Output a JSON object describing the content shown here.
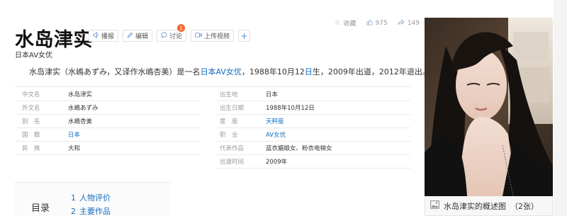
{
  "stats": {
    "favorite_label": "收藏",
    "likes": "975",
    "shares": "149"
  },
  "title": "水岛津实",
  "actions": {
    "broadcast": "播报",
    "edit": "编辑",
    "discuss": "讨论",
    "discuss_badge": "1",
    "upload_video": "上传视频",
    "add": "+"
  },
  "subtitle": "日本AV女优",
  "summary": {
    "part1": "水岛津实（水嶋あずみ，又译作水嶋杏美）是一名",
    "link1": "日本AV女优",
    "part2": "，1988年10月12",
    "link2": "日",
    "part3": "生，2009年出道，2012年退出。"
  },
  "infobox": {
    "left": [
      {
        "label": "中文名",
        "value": "水岛津实"
      },
      {
        "label": "外文名",
        "value": "水嶋あずみ"
      },
      {
        "label": "别　名",
        "value": "水嶋杏美"
      },
      {
        "label": "国　籍",
        "value": "日本"
      },
      {
        "label": "民　族",
        "value": "大和"
      }
    ],
    "right": [
      {
        "label": "出生地",
        "value": "日本"
      },
      {
        "label": "出生日期",
        "value": "1988年10月12日"
      },
      {
        "label": "星　座",
        "value": "天秤座"
      },
      {
        "label": "职　业",
        "value": "AV女优"
      },
      {
        "label": "代表作品",
        "value": "蓝衣媚娘女、粉衣电梯女"
      },
      {
        "label": "出道时间",
        "value": "2009年"
      }
    ]
  },
  "toc": {
    "title": "目录",
    "items": [
      {
        "num": "1",
        "label": "人物评价"
      },
      {
        "num": "2",
        "label": "主要作品"
      }
    ]
  },
  "photo": {
    "caption": "水岛津实的概述图",
    "count": "（2张）"
  },
  "colors": {
    "link": "#136ec2",
    "badge": "#f26b33",
    "icon_blue": "#5b8fd0"
  },
  "icons": [
    "star-icon",
    "thumbs-up-icon",
    "share-icon",
    "speaker-icon",
    "pencil-icon",
    "chat-bubble-icon",
    "video-icon",
    "plus-icon",
    "gallery-icon"
  ]
}
